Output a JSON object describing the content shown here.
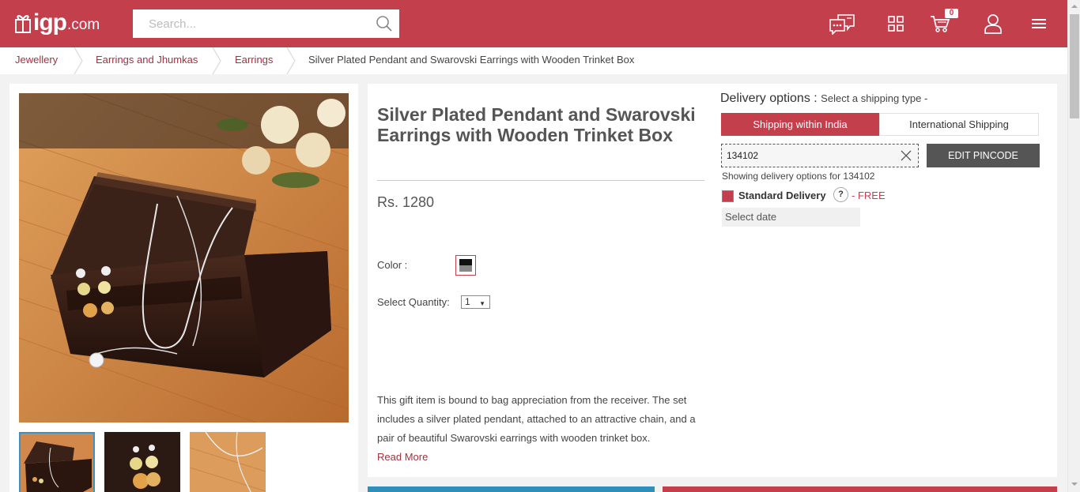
{
  "header": {
    "logo_text": "igp",
    "logo_domain": ".com",
    "search_placeholder": "Search...",
    "cart_count": "0",
    "icons": [
      "chat-icon",
      "grid-icon",
      "cart-icon",
      "user-icon",
      "menu-icon"
    ]
  },
  "breadcrumb": [
    "Jewellery",
    "Earrings and Jhumkas",
    "Earrings",
    "Silver Plated Pendant and Swarovski Earrings with Wooden Trinket Box"
  ],
  "product": {
    "title": "Silver Plated Pendant and Swarovski Earrings with Wooden Trinket Box",
    "price": "Rs. 1280",
    "color_label": "Color :",
    "quantity_label": "Select Quantity:",
    "quantity_value": "1",
    "description": "This gift item is bound to bag appreciation from the receiver. The set includes a silver plated pendant, attached to an attractive chain, and a pair of beautiful Swarovski earrings with wooden trinket box.",
    "read_more": "Read More"
  },
  "delivery": {
    "title": "Delivery options :",
    "subtitle": "Select a shipping type -",
    "tab_india": "Shipping within India",
    "tab_international": "International Shipping",
    "pincode": "134102",
    "edit_button": "EDIT PINCODE",
    "showing_text": "Showing delivery options for 134102",
    "standard_label": "Standard Delivery",
    "help_mark": "?",
    "free_label": "- FREE",
    "select_date": "Select date"
  },
  "colors": {
    "brand": "#c43f4c",
    "accent_blue": "#2f8fb9",
    "link": "#a1323d"
  }
}
